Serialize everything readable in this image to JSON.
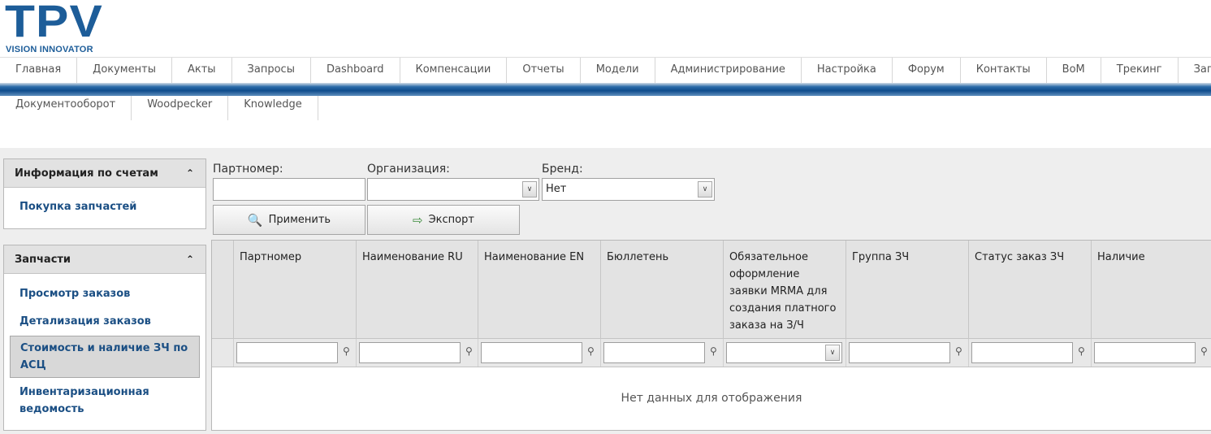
{
  "logo": {
    "main": "TPV",
    "sub": "VISION INNOVATOR"
  },
  "nav": {
    "row1": [
      "Главная",
      "Документы",
      "Акты",
      "Запросы",
      "Dashboard",
      "Компенсации",
      "Отчеты",
      "Модели",
      "Администрирование",
      "Настройка",
      "Форум",
      "Контакты",
      "BoM",
      "Трекинг",
      "Запчасти"
    ],
    "row2": [
      "Документооборот",
      "Woodpecker",
      "Knowledge"
    ]
  },
  "sidebar": {
    "panel1": {
      "title": "Информация по счетам",
      "links": [
        "Покупка запчастей"
      ]
    },
    "panel2": {
      "title": "Запчасти",
      "links": [
        "Просмотр заказов",
        "Детализация заказов",
        "Стоимость и наличие ЗЧ по АСЦ",
        "Инвентаризационная ведомость"
      ],
      "active_index": 2
    }
  },
  "filters": {
    "partnumber_label": "Партномер:",
    "partnumber_value": "",
    "organization_label": "Организация:",
    "organization_value": "",
    "brand_label": "Бренд:",
    "brand_value": "Нет",
    "apply_label": "Применить",
    "export_label": "Экспорт"
  },
  "grid": {
    "columns": [
      "Партномер",
      "Наименование RU",
      "Наименование EN",
      "Бюллетень",
      "Обязательное оформление заявки MRMA для создания платного заказа на З/Ч",
      "Группа ЗЧ",
      "Статус заказ ЗЧ",
      "Наличие"
    ],
    "empty_text": "Нет данных для отображения"
  },
  "icons": {
    "collapse": "chevron-double-up-icon",
    "apply": "magnifier-icon",
    "export": "export-icon",
    "filter": "pin-filter-icon",
    "dropdown": "chevron-down-icon"
  },
  "colors": {
    "brand": "#1d5d99",
    "link": "#1b4f84"
  }
}
